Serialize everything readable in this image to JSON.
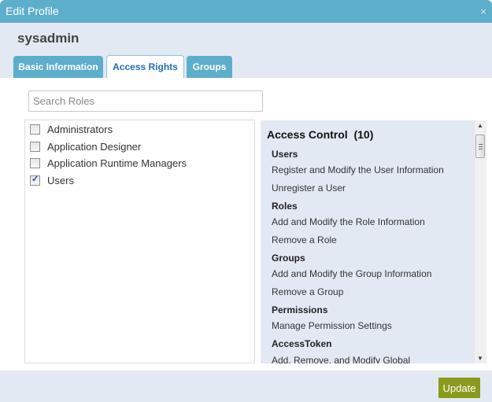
{
  "dialog": {
    "title": "Edit Profile",
    "close_icon": "×",
    "username": "sysadmin"
  },
  "tabs": [
    {
      "label": "Basic Information",
      "active": false
    },
    {
      "label": "Access Rights",
      "active": true
    },
    {
      "label": "Groups",
      "active": false
    }
  ],
  "search": {
    "placeholder": "Search Roles",
    "value": ""
  },
  "roles": [
    {
      "label": "Administrators",
      "checked": false
    },
    {
      "label": "Application Designer",
      "checked": false
    },
    {
      "label": "Application Runtime Managers",
      "checked": false
    },
    {
      "label": "Users",
      "checked": true
    }
  ],
  "permissions": {
    "title": "Access Control  (10)",
    "rows": [
      {
        "label": "Users",
        "type": "group"
      },
      {
        "label": "Register and Modify the User Information",
        "type": "item"
      },
      {
        "label": "Unregister a User",
        "type": "item"
      },
      {
        "label": "Roles",
        "type": "group"
      },
      {
        "label": "Add and Modify the Role Information",
        "type": "item"
      },
      {
        "label": "Remove a Role",
        "type": "item"
      },
      {
        "label": "Groups",
        "type": "group"
      },
      {
        "label": "Add and Modify the Group Information",
        "type": "item"
      },
      {
        "label": "Remove a Group",
        "type": "item"
      },
      {
        "label": "Permissions",
        "type": "group"
      },
      {
        "label": "Manage Permission Settings",
        "type": "item"
      },
      {
        "label": "AccessToken",
        "type": "group"
      },
      {
        "label": "Add, Remove, and Modify Global",
        "type": "item"
      }
    ]
  },
  "footer": {
    "update_label": "Update"
  },
  "colors": {
    "header": "#5daecb",
    "background": "#e2e9f3",
    "update_button": "#8a9a1b",
    "active_tab_text": "#1f6fb5"
  }
}
